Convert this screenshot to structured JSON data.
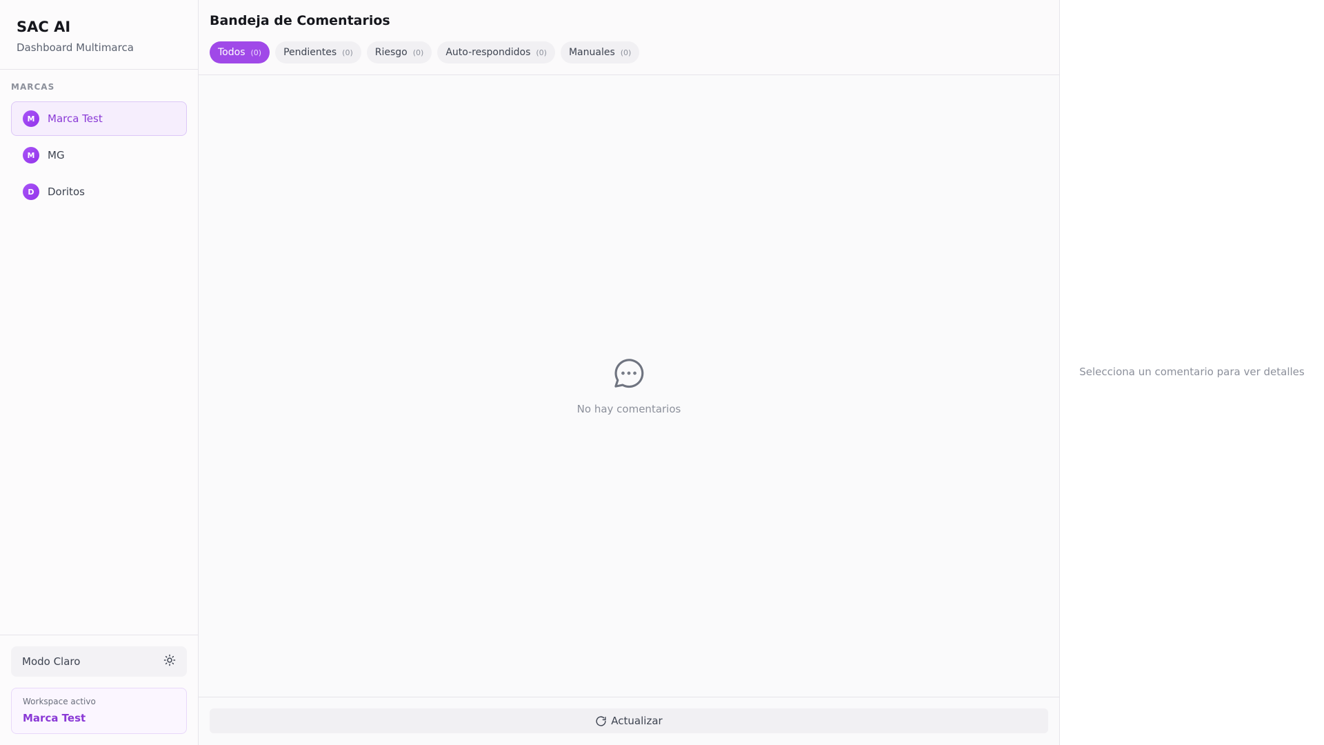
{
  "app": {
    "title": "SAC AI",
    "subtitle": "Dashboard Multimarca"
  },
  "sidebar": {
    "section_label": "MARCAS",
    "brands": [
      {
        "initial": "M",
        "name": "Marca Test",
        "active": true
      },
      {
        "initial": "M",
        "name": "MG",
        "active": false
      },
      {
        "initial": "D",
        "name": "Doritos",
        "active": false
      }
    ],
    "theme_toggle": {
      "label": "Modo Claro",
      "icon": "sun-icon"
    },
    "workspace": {
      "label": "Workspace activo",
      "name": "Marca Test"
    }
  },
  "main": {
    "title": "Bandeja de Comentarios",
    "tabs": [
      {
        "label": "Todos",
        "count": "(0)",
        "active": true
      },
      {
        "label": "Pendientes",
        "count": "(0)",
        "active": false
      },
      {
        "label": "Riesgo",
        "count": "(0)",
        "active": false
      },
      {
        "label": "Auto-respondidos",
        "count": "(0)",
        "active": false
      },
      {
        "label": "Manuales",
        "count": "(0)",
        "active": false
      }
    ],
    "empty_state": {
      "icon": "message-circle-icon",
      "text": "No hay comentarios"
    },
    "refresh_button": {
      "label": "Actualizar",
      "icon": "refresh-icon"
    }
  },
  "details": {
    "placeholder": "Selecciona un comentario para ver detalles"
  },
  "colors": {
    "accent": "#a049e8",
    "accent_text": "#8a39d6",
    "active_bg": "#f6eefd"
  }
}
